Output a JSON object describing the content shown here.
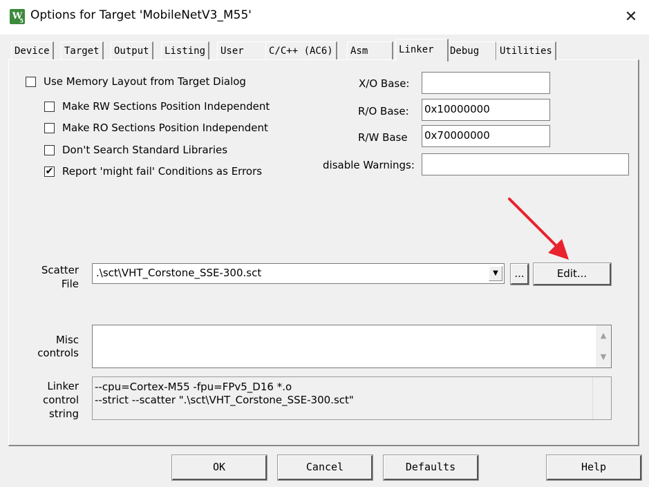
{
  "window": {
    "title": "Options for Target 'MobileNetV3_M55'",
    "app_icon_letter": "W",
    "app_icon_sub": "5",
    "close_glyph": "✕"
  },
  "tabs": [
    {
      "label": "Device"
    },
    {
      "label": "Target"
    },
    {
      "label": "Output"
    },
    {
      "label": "Listing"
    },
    {
      "label": "User"
    },
    {
      "label": "C/C++ (AC6)"
    },
    {
      "label": "Asm"
    },
    {
      "label": "Linker",
      "active": true
    },
    {
      "label": "Debug"
    },
    {
      "label": "Utilities"
    }
  ],
  "options": {
    "use_memory_layout": {
      "label": "Use Memory Layout from Target Dialog",
      "checked": false
    },
    "rw_independent": {
      "label": "Make RW Sections Position Independent",
      "checked": false
    },
    "ro_independent": {
      "label": "Make RO Sections Position Independent",
      "checked": false
    },
    "no_std_libs": {
      "label": "Don't Search Standard Libraries",
      "checked": false
    },
    "might_fail_errors": {
      "label": "Report 'might fail' Conditions as Errors",
      "checked": true
    }
  },
  "fields": {
    "xo_base": {
      "label": "X/O Base:",
      "value": ""
    },
    "ro_base": {
      "label": "R/O Base:",
      "value": "0x10000000"
    },
    "rw_base": {
      "label": "R/W Base",
      "value": "0x70000000"
    },
    "disable_warnings": {
      "label": "disable Warnings:",
      "value": ""
    }
  },
  "scatter": {
    "label_line1": "Scatter",
    "label_line2": "File",
    "value": ".\\sct\\VHT_Corstone_SSE-300.sct",
    "browse_label": "...",
    "edit_label": "Edit..."
  },
  "misc": {
    "label_line1": "Misc",
    "label_line2": "controls",
    "value": ""
  },
  "linker_string": {
    "label_line1": "Linker",
    "label_line2": "control",
    "label_line3": "string",
    "line1": "--cpu=Cortex-M55 -fpu=FPv5_D16 *.o",
    "line2": "--strict --scatter \".\\sct\\VHT_Corstone_SSE-300.sct\""
  },
  "buttons": {
    "ok": "OK",
    "cancel": "Cancel",
    "defaults": "Defaults",
    "help": "Help"
  },
  "colors": {
    "annotation_arrow": "#e8232e",
    "app_icon_bg": "#3c8a3c",
    "dialog_bg": "#f0f0f0"
  }
}
